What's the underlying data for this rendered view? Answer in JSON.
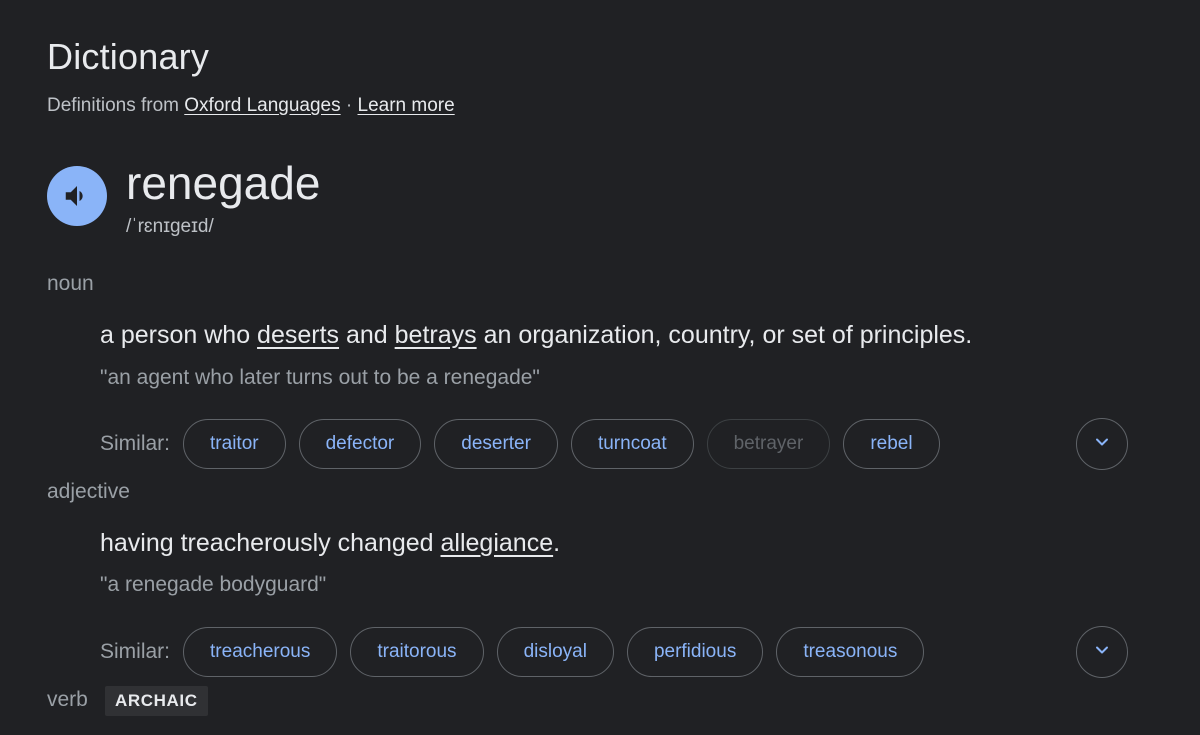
{
  "header": {
    "title": "Dictionary",
    "source_prefix": "Definitions from",
    "source_link": "Oxford Languages",
    "separator": "·",
    "learn_more": "Learn more"
  },
  "entry": {
    "word": "renegade",
    "phonetic": "/ˈrɛnɪɡeɪd/",
    "speaker_icon": "volume-up-icon"
  },
  "noun": {
    "pos": "noun",
    "def_1": "a person who ",
    "def_link_1": "deserts",
    "def_2": " and ",
    "def_link_2": "betrays",
    "def_3": " an organization, country, or set of principles.",
    "example": "\"an agent who later turns out to be a renegade\"",
    "similar_label": "Similar:",
    "similar": [
      "traitor",
      "defector",
      "deserter",
      "turncoat",
      "betrayer",
      "rebel"
    ]
  },
  "adjective": {
    "pos": "adjective",
    "def_1": "having treacherously changed ",
    "def_link_1": "allegiance",
    "def_2": ".",
    "example": "\"a renegade bodyguard\"",
    "similar_label": "Similar:",
    "similar": [
      "treacherous",
      "traitorous",
      "disloyal",
      "perfidious",
      "treasonous"
    ]
  },
  "verb": {
    "pos": "verb",
    "badge": "ARCHAIC"
  },
  "colors": {
    "background": "#202124",
    "accent": "#8ab4f8",
    "text": "#e8eaed",
    "muted": "#9aa0a6"
  },
  "icons": {
    "expand": "chevron-down-icon"
  }
}
